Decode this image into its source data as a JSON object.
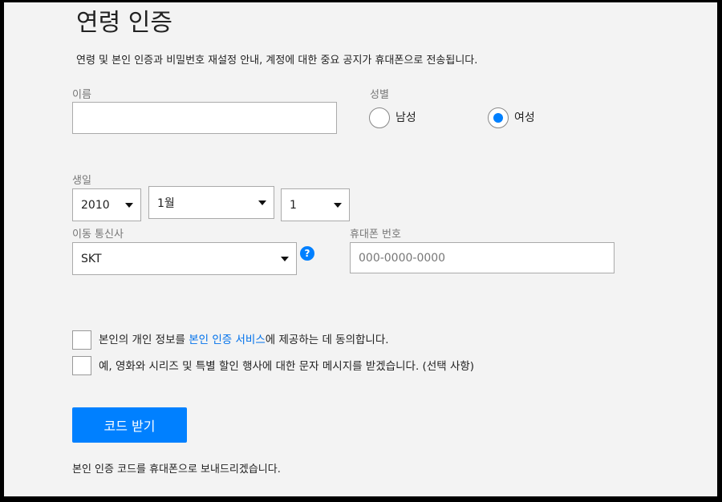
{
  "page": {
    "title": "연령 인증",
    "description": "연령 및 본인 인증과 비밀번호 재설정 안내, 계정에 대한 중요 공지가 휴대폰으로 전송됩니다."
  },
  "form": {
    "name": {
      "label": "이름",
      "value": ""
    },
    "gender": {
      "label": "성별",
      "options": [
        {
          "label": "남성",
          "selected": false
        },
        {
          "label": "여성",
          "selected": true
        }
      ]
    },
    "birthday": {
      "label": "생일",
      "year": "2010",
      "month": "1월",
      "day": "1"
    },
    "carrier": {
      "label": "이동 통신사",
      "value": "SKT",
      "help_icon": "?"
    },
    "phone": {
      "label": "휴대폰 번호",
      "placeholder": "000-0000-0000",
      "value": ""
    },
    "consent": {
      "prefix": "본인의 개인 정보를 ",
      "link_text": "본인 인증 서비스",
      "suffix": "에 제공하는 데 동의합니다.",
      "checked": false
    },
    "marketing": {
      "text": "예, 영화와 시리즈 및 특별 할인 행사에 대한 문자 메시지를 받겠습니다. (선택 사항)",
      "checked": false
    },
    "submit_label": "코드 받기",
    "footnote": "본인 인증 코드를 휴대폰으로 보내드리겠습니다."
  },
  "colors": {
    "accent": "#0080ff",
    "link": "#0071eb",
    "background": "#f3f3f3"
  },
  "icons": {
    "help": "help-icon",
    "caret": "caret-down-icon"
  }
}
